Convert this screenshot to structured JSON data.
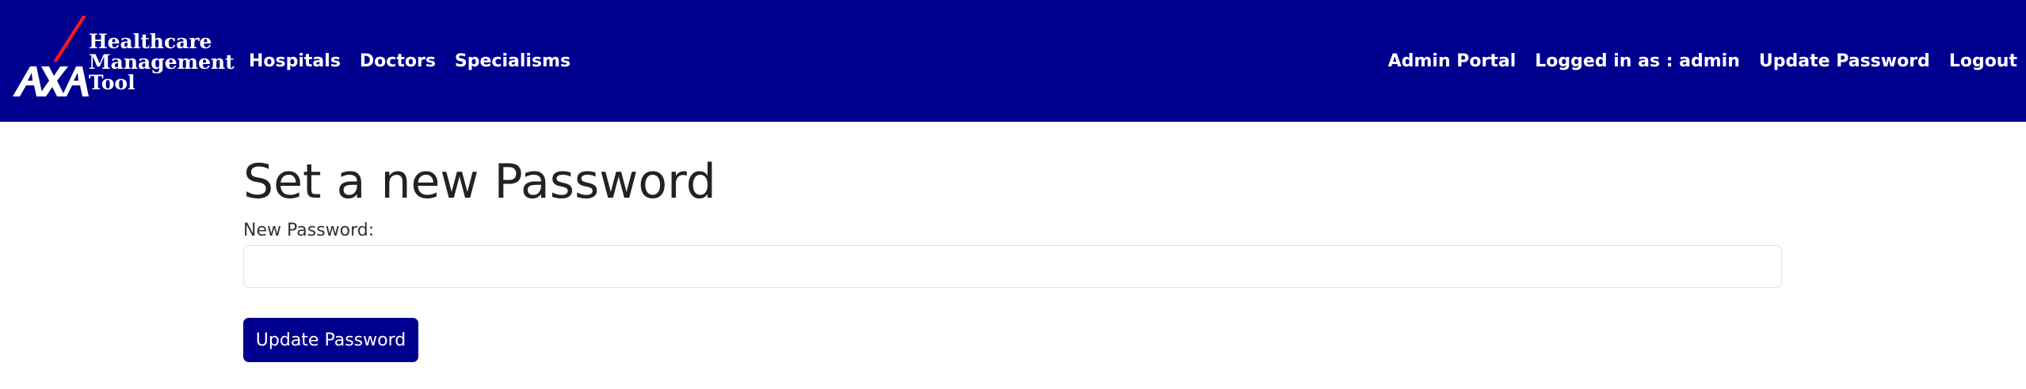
{
  "brand": {
    "logo_text": "AXA",
    "lines": [
      "Healthcare",
      "Management",
      "Tool"
    ],
    "accent_color": "#ff1721",
    "brand_color": "#00008f"
  },
  "nav": {
    "left": [
      "Hospitals",
      "Doctors",
      "Specialisms"
    ],
    "right": [
      "Admin Portal",
      "Logged in as : admin",
      "Update Password",
      "Logout"
    ]
  },
  "main": {
    "title": "Set a new Password",
    "password_label": "New Password:",
    "password_value": "",
    "submit_label": "Update Password"
  }
}
